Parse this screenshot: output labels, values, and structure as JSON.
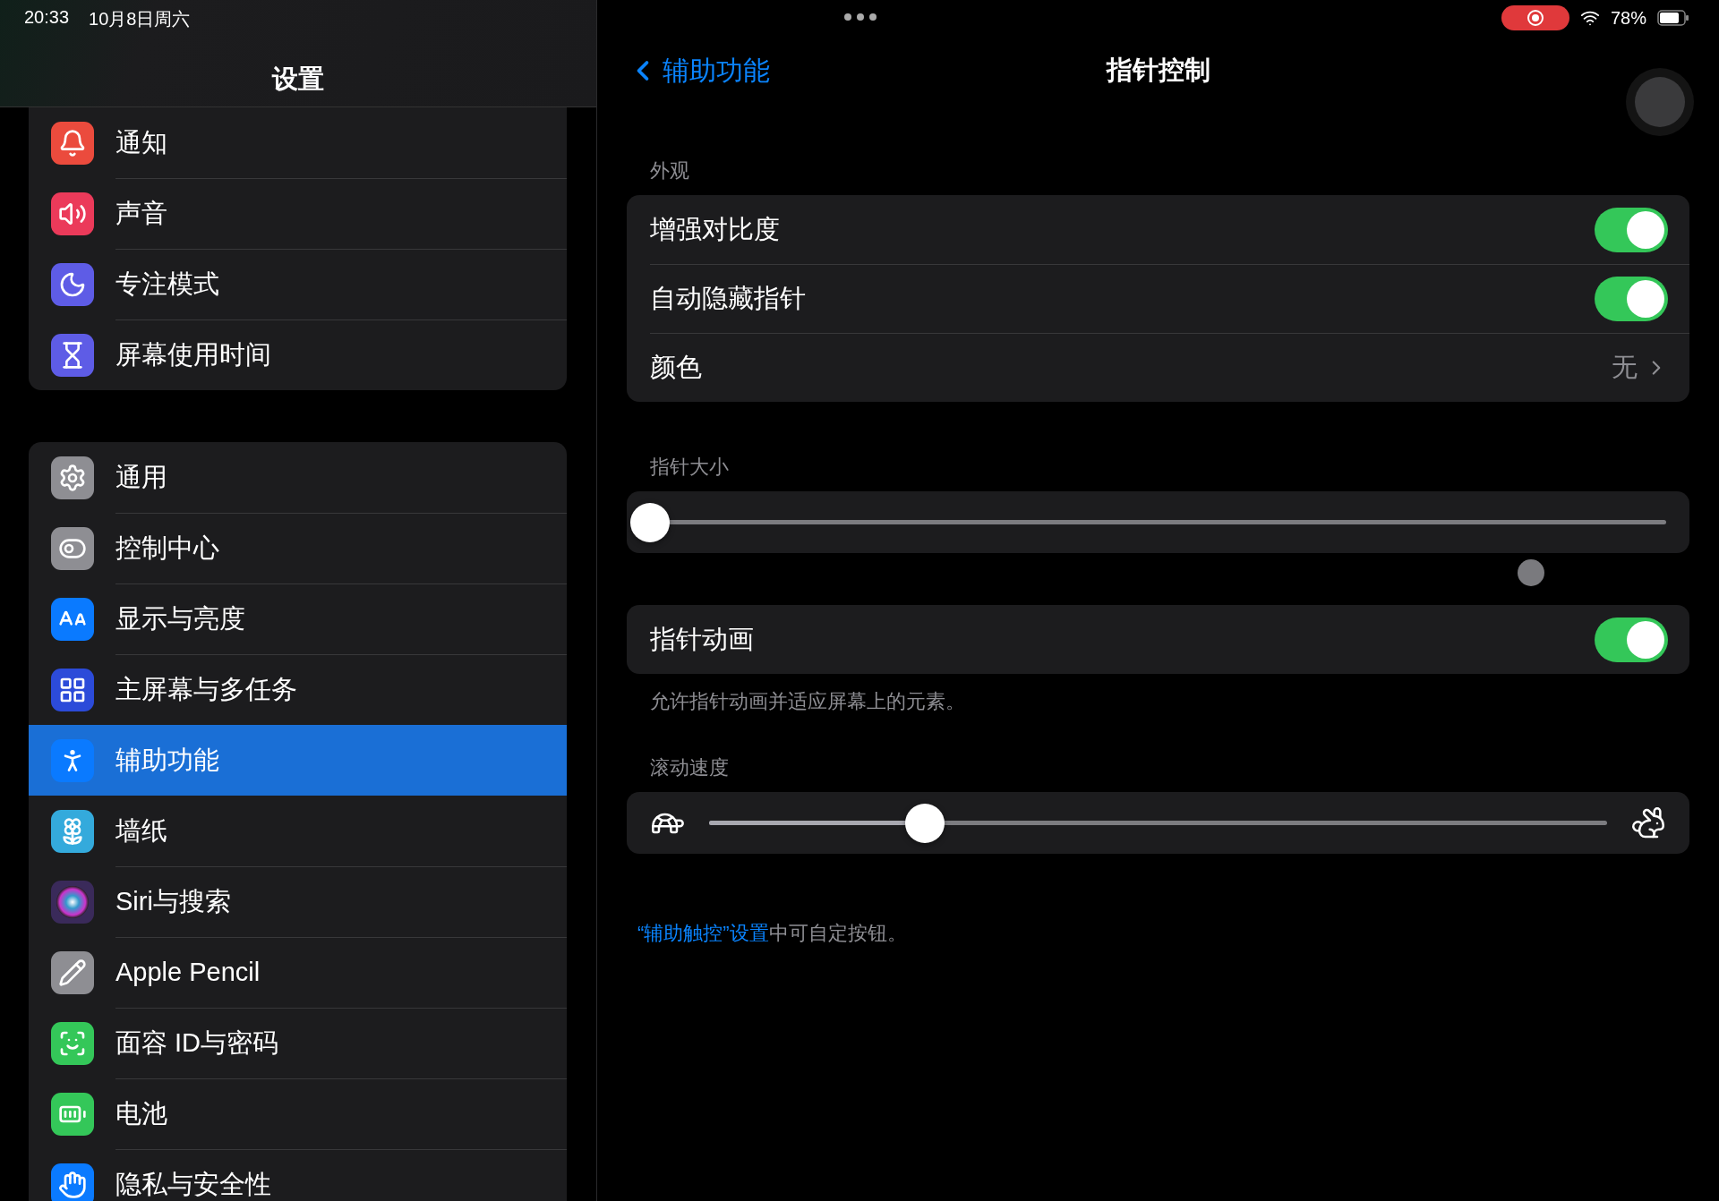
{
  "status_bar": {
    "time": "20:33",
    "date": "10月8日周六",
    "battery": "78%"
  },
  "sidebar": {
    "title": "设置",
    "groups": [
      {
        "items": [
          {
            "label": "通知",
            "color": "#eb4b3d",
            "selected": false
          },
          {
            "label": "声音",
            "color": "#eb3a5a",
            "selected": false
          },
          {
            "label": "专注模式",
            "color": "#5e5ce6",
            "selected": false
          },
          {
            "label": "屏幕使用时间",
            "color": "#5e5ce6",
            "selected": false
          }
        ]
      },
      {
        "items": [
          {
            "label": "通用",
            "color": "#8e8e93",
            "selected": false
          },
          {
            "label": "控制中心",
            "color": "#8e8e93",
            "selected": false
          },
          {
            "label": "显示与亮度",
            "color": "#0a7aff",
            "selected": false
          },
          {
            "label": "主屏幕与多任务",
            "color": "#2c4bd9",
            "selected": false
          },
          {
            "label": "辅助功能",
            "color": "#0a7aff",
            "selected": true
          },
          {
            "label": "墙纸",
            "color": "#34aadc",
            "selected": false
          },
          {
            "label": "Siri与搜索",
            "color": "#3a2a5a",
            "selected": false
          },
          {
            "label": "Apple Pencil",
            "color": "#8e8e93",
            "selected": false
          },
          {
            "label": "面容 ID与密码",
            "color": "#34c759",
            "selected": false
          },
          {
            "label": "电池",
            "color": "#34c759",
            "selected": false
          },
          {
            "label": "隐私与安全性",
            "color": "#0a7aff",
            "selected": false
          }
        ]
      }
    ]
  },
  "detail": {
    "back": "辅助功能",
    "title": "指针控制",
    "appearance": {
      "header": "外观",
      "rows": [
        {
          "kind": "toggle",
          "label": "增强对比度",
          "on": true
        },
        {
          "kind": "toggle",
          "label": "自动隐藏指针",
          "on": true
        },
        {
          "kind": "value",
          "label": "颜色",
          "value": "无"
        }
      ]
    },
    "pointer_size": {
      "header": "指针大小",
      "level": 0
    },
    "pointer_animation": {
      "label": "指针动画",
      "on": true,
      "footer": "允许指针动画并适应屏幕上的元素。"
    },
    "scroll_speed": {
      "header": "滚动速度",
      "level": 0.24
    },
    "note": {
      "link": "“辅助触控”设置",
      "text": "中可自定按钮。"
    }
  }
}
